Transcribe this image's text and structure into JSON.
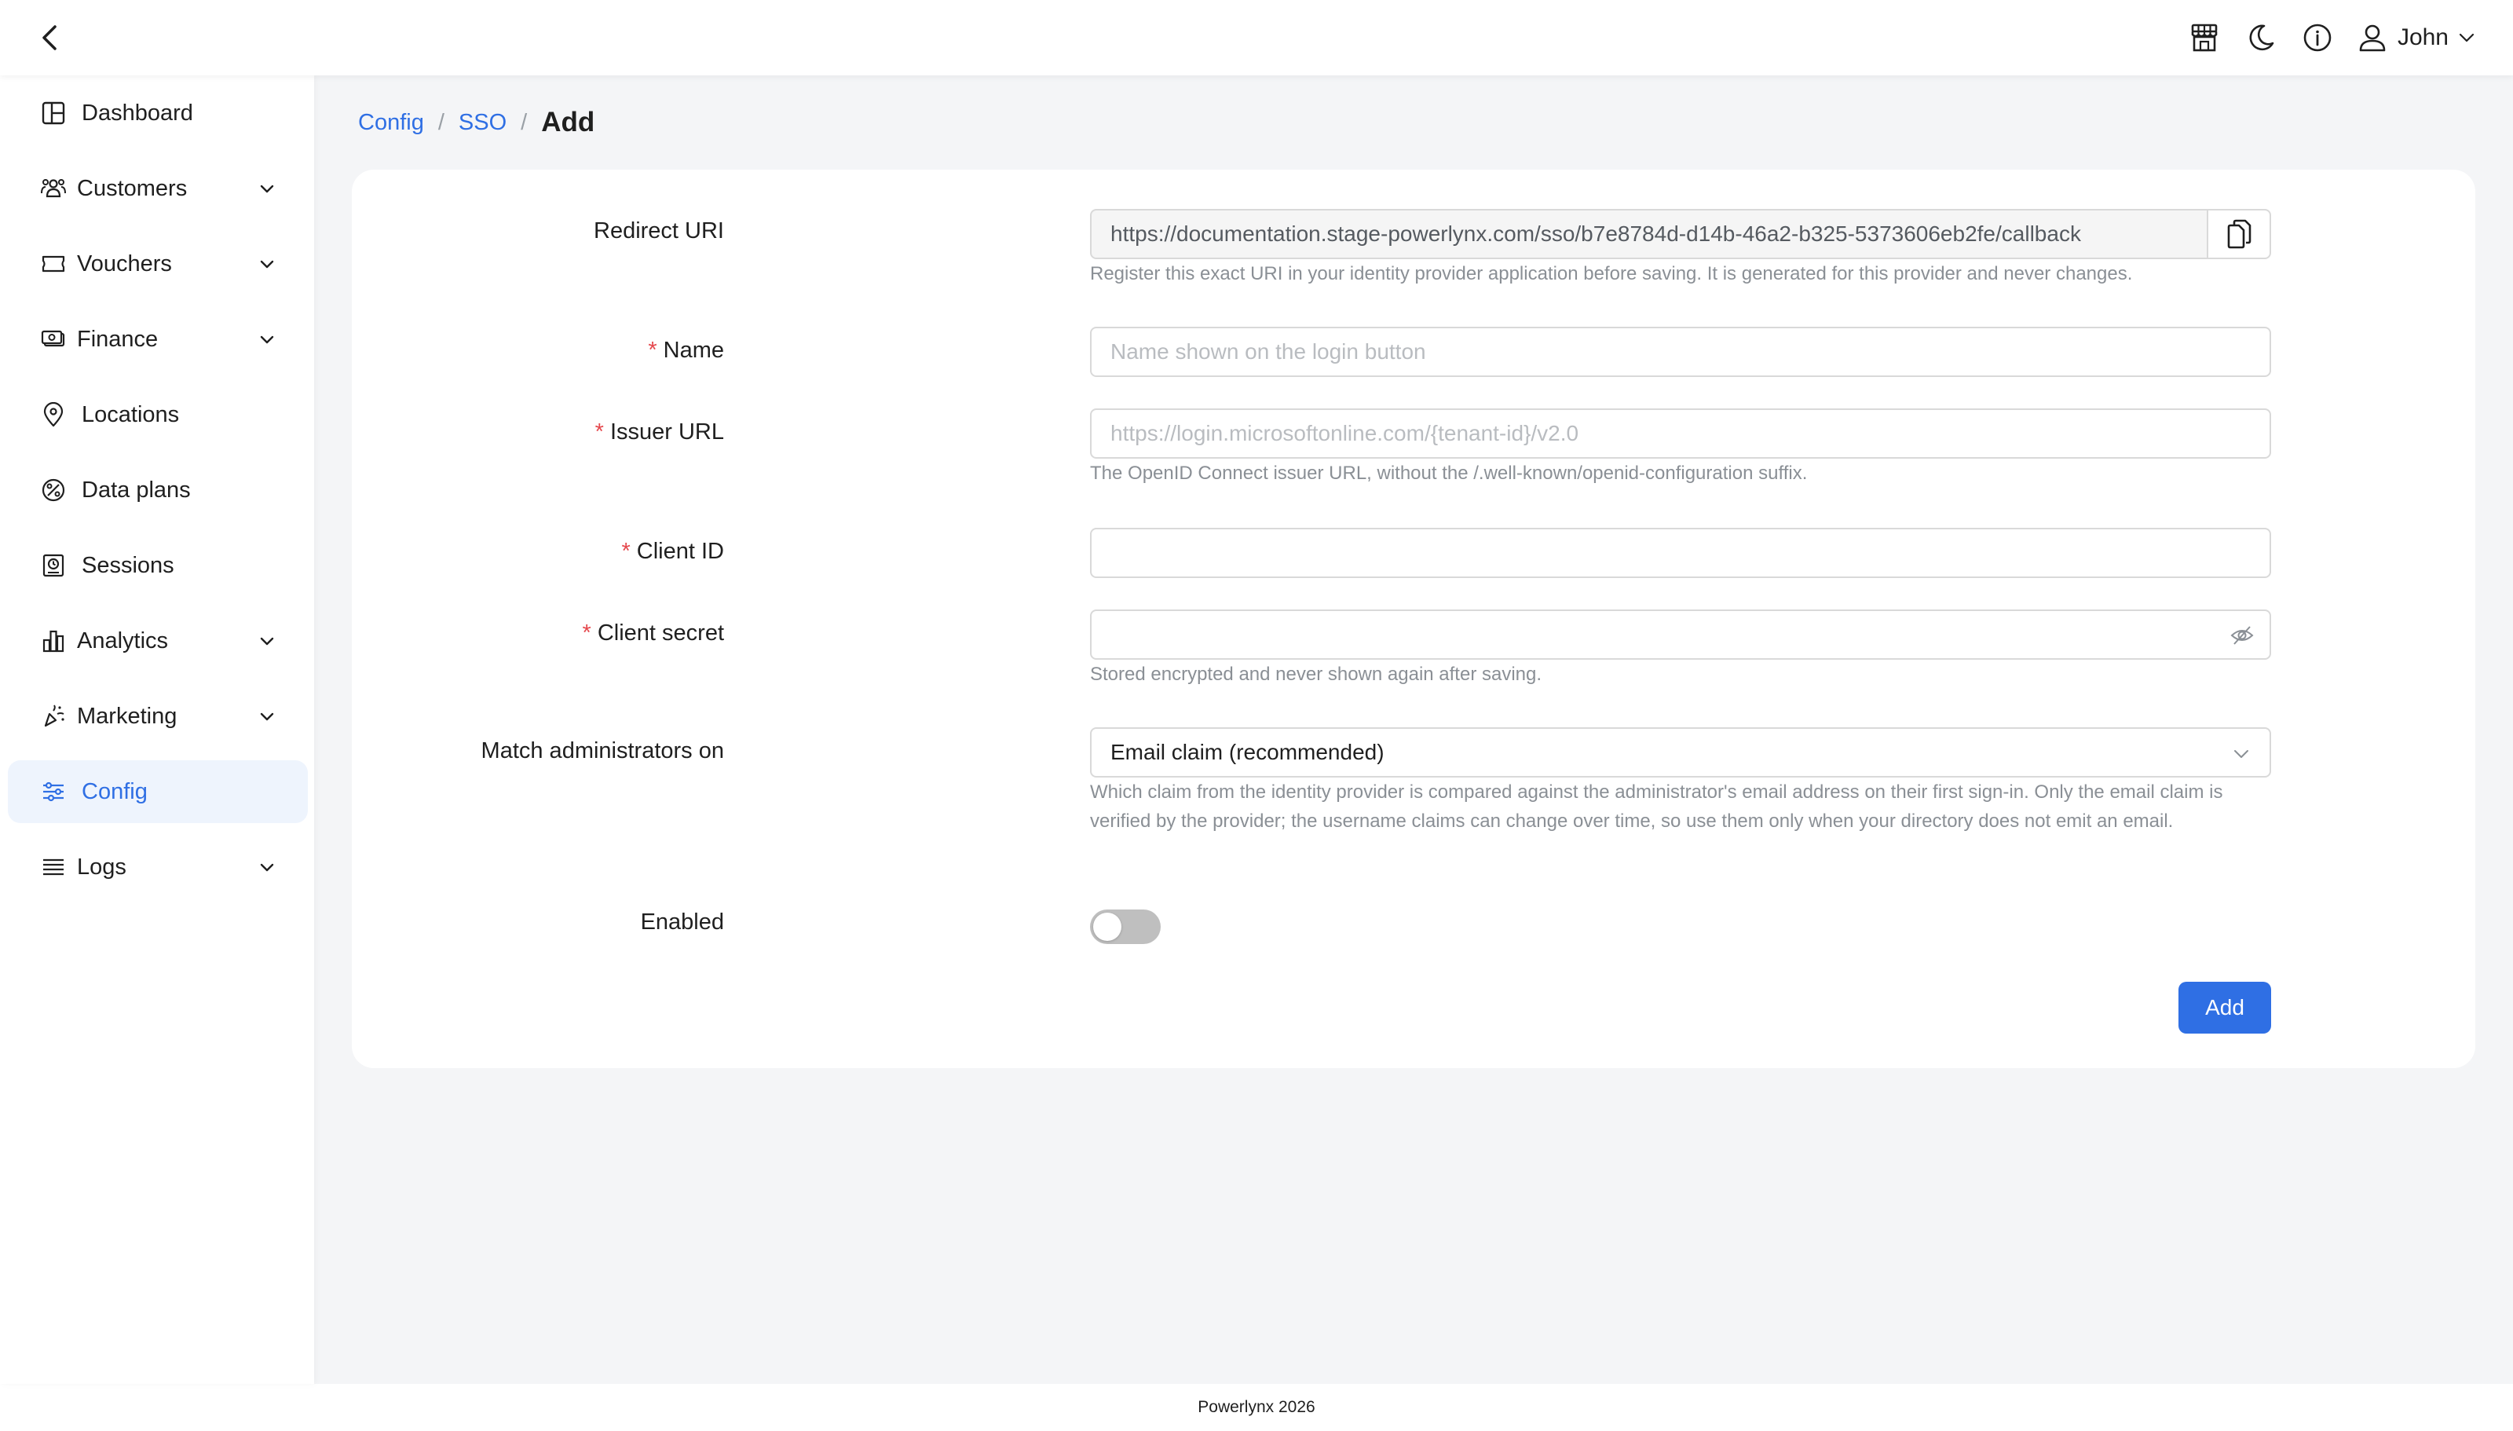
{
  "header": {
    "user_name": "John",
    "icons": [
      "back-arrow-icon",
      "store-icon",
      "moon-icon",
      "info-icon",
      "user-icon",
      "chevron-down-icon"
    ]
  },
  "sidebar": {
    "items": [
      {
        "label": "Dashboard",
        "icon": "dashboard-icon",
        "has_sub": false
      },
      {
        "label": "Customers",
        "icon": "customers-icon",
        "has_sub": true
      },
      {
        "label": "Vouchers",
        "icon": "voucher-icon",
        "has_sub": true
      },
      {
        "label": "Finance",
        "icon": "finance-icon",
        "has_sub": true
      },
      {
        "label": "Locations",
        "icon": "location-pin-icon",
        "has_sub": false
      },
      {
        "label": "Data plans",
        "icon": "data-plans-icon",
        "has_sub": false
      },
      {
        "label": "Sessions",
        "icon": "sessions-icon",
        "has_sub": false
      },
      {
        "label": "Analytics",
        "icon": "analytics-icon",
        "has_sub": true
      },
      {
        "label": "Marketing",
        "icon": "marketing-icon",
        "has_sub": true
      },
      {
        "label": "Config",
        "icon": "config-icon",
        "has_sub": false,
        "active": true
      },
      {
        "label": "Logs",
        "icon": "logs-icon",
        "has_sub": true
      }
    ]
  },
  "breadcrumb": {
    "items": [
      "Config",
      "SSO"
    ],
    "separator": "/",
    "current": "Add"
  },
  "form": {
    "redirect_uri": {
      "label": "Redirect URI",
      "value": "https://documentation.stage-powerlynx.com/sso/b7e8784d-d14b-46a2-b325-5373606eb2fe/callback",
      "help": "Register this exact URI in your identity provider application before saving. It is generated for this provider and never changes."
    },
    "name": {
      "label": "Name",
      "required_mark": "*",
      "placeholder": "Name shown on the login button",
      "value": ""
    },
    "issuer_url": {
      "label": "Issuer URL",
      "required_mark": "*",
      "placeholder": "https://login.microsoftonline.com/{tenant-id}/v2.0",
      "value": "",
      "help": "The OpenID Connect issuer URL, without the /.well-known/openid-configuration suffix."
    },
    "client_id": {
      "label": "Client ID",
      "required_mark": "*",
      "value": ""
    },
    "client_secret": {
      "label": "Client secret",
      "required_mark": "*",
      "value": "",
      "help": "Stored encrypted and never shown again after saving."
    },
    "match_admins": {
      "label": "Match administrators on",
      "selected": "Email claim (recommended)",
      "help": "Which claim from the identity provider is compared against the administrator's email address on their first sign-in. Only the email claim is verified by the provider; the username claims can change over time, so use them only when your directory does not emit an email."
    },
    "enabled": {
      "label": "Enabled",
      "on": false
    },
    "submit_label": "Add"
  },
  "footer": {
    "text": "Powerlynx 2026"
  },
  "colors": {
    "accent": "#2f6fe4",
    "required": "#e5484d",
    "active_bg": "#eef4fd"
  }
}
